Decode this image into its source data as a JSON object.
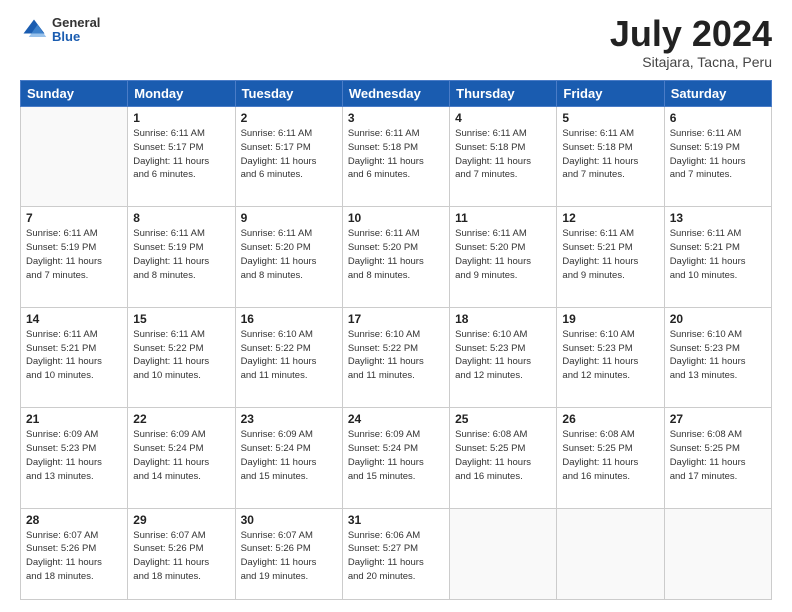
{
  "header": {
    "logo_general": "General",
    "logo_blue": "Blue",
    "title": "July 2024",
    "location": "Sitajara, Tacna, Peru"
  },
  "days_of_week": [
    "Sunday",
    "Monday",
    "Tuesday",
    "Wednesday",
    "Thursday",
    "Friday",
    "Saturday"
  ],
  "weeks": [
    [
      {
        "day": "",
        "info": ""
      },
      {
        "day": "1",
        "info": "Sunrise: 6:11 AM\nSunset: 5:17 PM\nDaylight: 11 hours\nand 6 minutes."
      },
      {
        "day": "2",
        "info": "Sunrise: 6:11 AM\nSunset: 5:17 PM\nDaylight: 11 hours\nand 6 minutes."
      },
      {
        "day": "3",
        "info": "Sunrise: 6:11 AM\nSunset: 5:18 PM\nDaylight: 11 hours\nand 6 minutes."
      },
      {
        "day": "4",
        "info": "Sunrise: 6:11 AM\nSunset: 5:18 PM\nDaylight: 11 hours\nand 7 minutes."
      },
      {
        "day": "5",
        "info": "Sunrise: 6:11 AM\nSunset: 5:18 PM\nDaylight: 11 hours\nand 7 minutes."
      },
      {
        "day": "6",
        "info": "Sunrise: 6:11 AM\nSunset: 5:19 PM\nDaylight: 11 hours\nand 7 minutes."
      }
    ],
    [
      {
        "day": "7",
        "info": "Sunrise: 6:11 AM\nSunset: 5:19 PM\nDaylight: 11 hours\nand 7 minutes."
      },
      {
        "day": "8",
        "info": "Sunrise: 6:11 AM\nSunset: 5:19 PM\nDaylight: 11 hours\nand 8 minutes."
      },
      {
        "day": "9",
        "info": "Sunrise: 6:11 AM\nSunset: 5:20 PM\nDaylight: 11 hours\nand 8 minutes."
      },
      {
        "day": "10",
        "info": "Sunrise: 6:11 AM\nSunset: 5:20 PM\nDaylight: 11 hours\nand 8 minutes."
      },
      {
        "day": "11",
        "info": "Sunrise: 6:11 AM\nSunset: 5:20 PM\nDaylight: 11 hours\nand 9 minutes."
      },
      {
        "day": "12",
        "info": "Sunrise: 6:11 AM\nSunset: 5:21 PM\nDaylight: 11 hours\nand 9 minutes."
      },
      {
        "day": "13",
        "info": "Sunrise: 6:11 AM\nSunset: 5:21 PM\nDaylight: 11 hours\nand 10 minutes."
      }
    ],
    [
      {
        "day": "14",
        "info": "Sunrise: 6:11 AM\nSunset: 5:21 PM\nDaylight: 11 hours\nand 10 minutes."
      },
      {
        "day": "15",
        "info": "Sunrise: 6:11 AM\nSunset: 5:22 PM\nDaylight: 11 hours\nand 10 minutes."
      },
      {
        "day": "16",
        "info": "Sunrise: 6:10 AM\nSunset: 5:22 PM\nDaylight: 11 hours\nand 11 minutes."
      },
      {
        "day": "17",
        "info": "Sunrise: 6:10 AM\nSunset: 5:22 PM\nDaylight: 11 hours\nand 11 minutes."
      },
      {
        "day": "18",
        "info": "Sunrise: 6:10 AM\nSunset: 5:23 PM\nDaylight: 11 hours\nand 12 minutes."
      },
      {
        "day": "19",
        "info": "Sunrise: 6:10 AM\nSunset: 5:23 PM\nDaylight: 11 hours\nand 12 minutes."
      },
      {
        "day": "20",
        "info": "Sunrise: 6:10 AM\nSunset: 5:23 PM\nDaylight: 11 hours\nand 13 minutes."
      }
    ],
    [
      {
        "day": "21",
        "info": "Sunrise: 6:09 AM\nSunset: 5:23 PM\nDaylight: 11 hours\nand 13 minutes."
      },
      {
        "day": "22",
        "info": "Sunrise: 6:09 AM\nSunset: 5:24 PM\nDaylight: 11 hours\nand 14 minutes."
      },
      {
        "day": "23",
        "info": "Sunrise: 6:09 AM\nSunset: 5:24 PM\nDaylight: 11 hours\nand 15 minutes."
      },
      {
        "day": "24",
        "info": "Sunrise: 6:09 AM\nSunset: 5:24 PM\nDaylight: 11 hours\nand 15 minutes."
      },
      {
        "day": "25",
        "info": "Sunrise: 6:08 AM\nSunset: 5:25 PM\nDaylight: 11 hours\nand 16 minutes."
      },
      {
        "day": "26",
        "info": "Sunrise: 6:08 AM\nSunset: 5:25 PM\nDaylight: 11 hours\nand 16 minutes."
      },
      {
        "day": "27",
        "info": "Sunrise: 6:08 AM\nSunset: 5:25 PM\nDaylight: 11 hours\nand 17 minutes."
      }
    ],
    [
      {
        "day": "28",
        "info": "Sunrise: 6:07 AM\nSunset: 5:26 PM\nDaylight: 11 hours\nand 18 minutes."
      },
      {
        "day": "29",
        "info": "Sunrise: 6:07 AM\nSunset: 5:26 PM\nDaylight: 11 hours\nand 18 minutes."
      },
      {
        "day": "30",
        "info": "Sunrise: 6:07 AM\nSunset: 5:26 PM\nDaylight: 11 hours\nand 19 minutes."
      },
      {
        "day": "31",
        "info": "Sunrise: 6:06 AM\nSunset: 5:27 PM\nDaylight: 11 hours\nand 20 minutes."
      },
      {
        "day": "",
        "info": ""
      },
      {
        "day": "",
        "info": ""
      },
      {
        "day": "",
        "info": ""
      }
    ]
  ]
}
